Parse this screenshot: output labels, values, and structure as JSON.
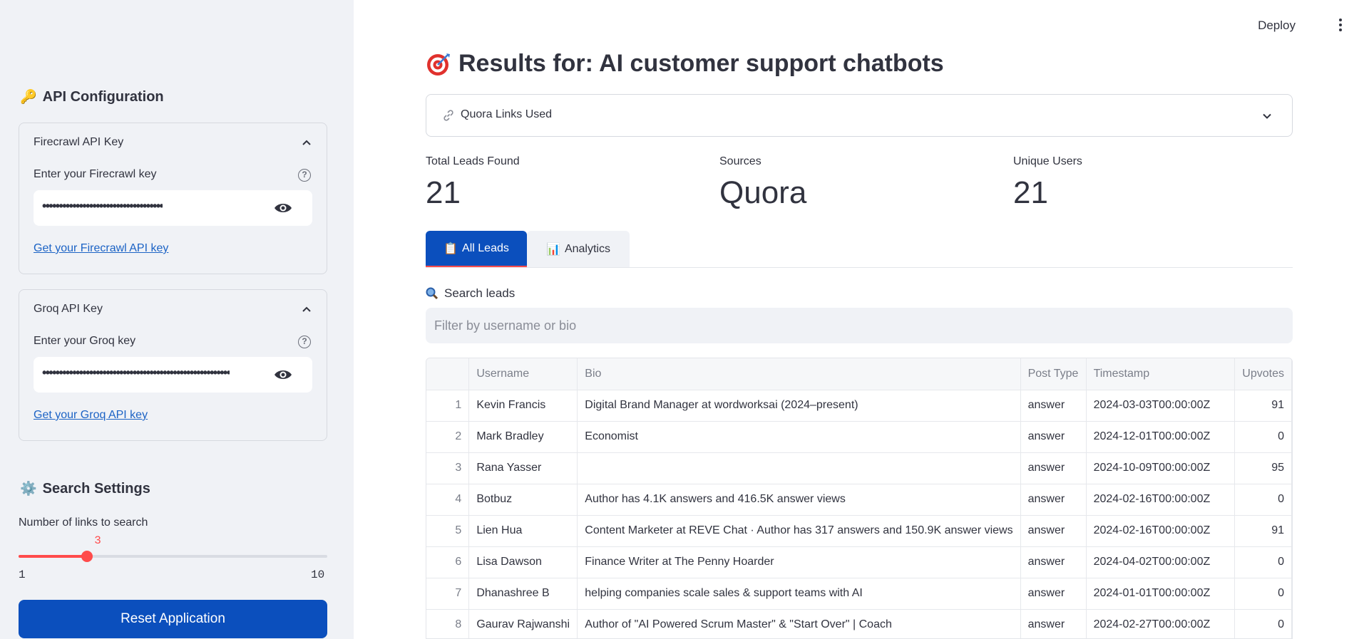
{
  "sidebar": {
    "api_heading": "API Configuration",
    "firecrawl": {
      "header": "Firecrawl API Key",
      "label": "Enter your Firecrawl key",
      "masked_value": "••••••••••••••••••••••••••••••••••••",
      "link": "Get your Firecrawl API key"
    },
    "groq": {
      "header": "Groq API Key",
      "label": "Enter your Groq key",
      "masked_value": "••••••••••••••••••••••••••••••••••••••••••••••••••••••••",
      "link": "Get your Groq API key"
    },
    "search_heading": "Search Settings",
    "slider": {
      "label": "Number of links to search",
      "value": "3",
      "min": "1",
      "max": "10"
    },
    "reset_label": "Reset Application"
  },
  "header": {
    "deploy": "Deploy"
  },
  "main": {
    "title": "Results for: AI customer support chatbots",
    "links_expander": "Quora Links Used",
    "metrics": [
      {
        "label": "Total Leads Found",
        "value": "21"
      },
      {
        "label": "Sources",
        "value": "Quora"
      },
      {
        "label": "Unique Users",
        "value": "21"
      }
    ],
    "tabs": [
      {
        "label": "All Leads",
        "emoji": "📋"
      },
      {
        "label": "Analytics",
        "emoji": "📊"
      }
    ],
    "search": {
      "label": "Search leads",
      "placeholder": "Filter by username or bio"
    }
  },
  "table": {
    "columns": [
      "",
      "Username",
      "Bio",
      "Post Type",
      "Timestamp",
      "Upvotes"
    ],
    "rows": [
      {
        "idx": "1",
        "username": "Kevin Francis",
        "bio": "Digital Brand Manager at wordworksai (2024–present)",
        "post_type": "answer",
        "timestamp": "2024-03-03T00:00:00Z",
        "upvotes": "91"
      },
      {
        "idx": "2",
        "username": "Mark Bradley",
        "bio": "Economist",
        "post_type": "answer",
        "timestamp": "2024-12-01T00:00:00Z",
        "upvotes": "0"
      },
      {
        "idx": "3",
        "username": "Rana Yasser",
        "bio": "",
        "post_type": "answer",
        "timestamp": "2024-10-09T00:00:00Z",
        "upvotes": "95"
      },
      {
        "idx": "4",
        "username": "Botbuz",
        "bio": "Author has 4.1K answers and 416.5K answer views",
        "post_type": "answer",
        "timestamp": "2024-02-16T00:00:00Z",
        "upvotes": "0"
      },
      {
        "idx": "5",
        "username": "Lien Hua",
        "bio": "Content Marketer at REVE Chat · Author has 317 answers and 150.9K answer views",
        "post_type": "answer",
        "timestamp": "2024-02-16T00:00:00Z",
        "upvotes": "91"
      },
      {
        "idx": "6",
        "username": "Lisa Dawson",
        "bio": "Finance Writer at The Penny Hoarder",
        "post_type": "answer",
        "timestamp": "2024-04-02T00:00:00Z",
        "upvotes": "0"
      },
      {
        "idx": "7",
        "username": "Dhanashree B",
        "bio": "helping companies scale sales & support teams with AI",
        "post_type": "answer",
        "timestamp": "2024-01-01T00:00:00Z",
        "upvotes": "0"
      },
      {
        "idx": "8",
        "username": "Gaurav Rajwanshi",
        "bio": "Author of \"AI Powered Scrum Master\" & \"Start Over\" | Coach",
        "post_type": "answer",
        "timestamp": "2024-02-27T00:00:00Z",
        "upvotes": "0"
      }
    ]
  },
  "colors": {
    "primary": "#0b4fbd",
    "accent": "#ff4b4b",
    "sidebar_bg": "#f0f2f6",
    "link": "#1c63c5"
  },
  "icons": [
    "key-icon",
    "chevron-up-icon",
    "help-icon",
    "eye-icon",
    "gear-icon",
    "target-icon",
    "link-icon",
    "chevron-down-icon",
    "clipboard-icon",
    "bar-chart-icon",
    "magnifier-icon",
    "kebab-menu-icon"
  ]
}
